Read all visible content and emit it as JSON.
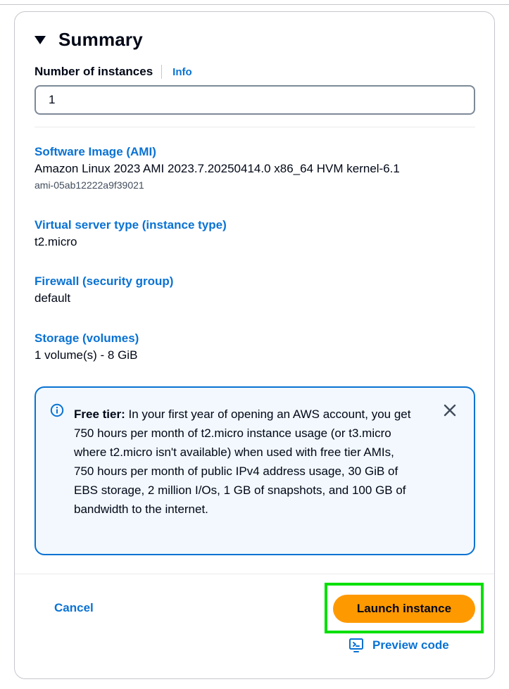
{
  "summary": {
    "title": "Summary",
    "instances": {
      "label": "Number of instances",
      "info_label": "Info",
      "value": "1"
    },
    "sections": [
      {
        "label": "Software Image (AMI)",
        "value": "Amazon Linux 2023 AMI 2023.7.20250414.0 x86_64 HVM kernel-6.1",
        "sub": "ami-05ab12222a9f39021"
      },
      {
        "label": "Virtual server type (instance type)",
        "value": "t2.micro"
      },
      {
        "label": "Firewall (security group)",
        "value": "default"
      },
      {
        "label": "Storage (volumes)",
        "value": "1 volume(s) - 8 GiB"
      }
    ],
    "alert": {
      "heading": "Free tier:",
      "body": " In your first year of opening an AWS account, you get 750 hours per month of t2.micro instance usage (or t3.micro where t2.micro isn't available) when used with free tier AMIs, 750 hours per month of public IPv4 address usage, 30 GiB of EBS storage, 2 million I/Os, 1 GB of snapshots, and 100 GB of bandwidth to the internet."
    }
  },
  "actions": {
    "cancel_label": "Cancel",
    "launch_label": "Launch instance",
    "preview_label": "Preview code"
  },
  "icons": {
    "collapse": "caret-down-icon",
    "alert": "info-icon",
    "close": "close-icon",
    "preview": "code-preview-icon"
  },
  "colors": {
    "link": "#0972d3",
    "primary_button": "#ff9900",
    "alert_border": "#0972d3",
    "alert_background": "#f2f8fd",
    "highlight_frame": "#00e000"
  }
}
